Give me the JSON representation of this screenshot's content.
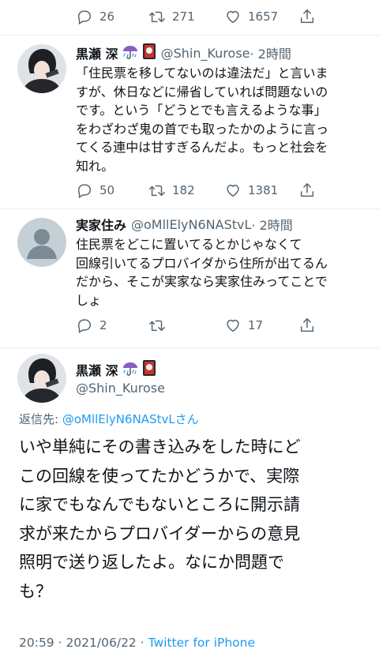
{
  "colors": {
    "link": "#1d9bf0",
    "muted": "#536471",
    "text": "#0f1419",
    "divider": "#e6ecf0"
  },
  "top_actions": {
    "replies": "26",
    "retweets": "271",
    "likes": "1657"
  },
  "tweet1": {
    "author": "黒瀬 深",
    "handle": "@Shin_Kurose",
    "time": "· 2時間",
    "lines": [
      "「住民票を移してないのは違法だ」と言いま",
      "すが、休日などに帰省していれば問題ないの",
      "です。という「どうとでも言えるような事」",
      "をわざわざ鬼の首でも取ったかのように言っ",
      "てくる連中は甘すぎるんだよ。もっと社会を",
      "知れ。"
    ],
    "replies": "50",
    "retweets": "182",
    "likes": "1381"
  },
  "tweet2": {
    "author": "実家住み",
    "handle": "@oMllElyN6NAStvL",
    "time": "· 2時間",
    "lines": [
      "住民票をどこに置いてるとかじゃなくて",
      "回線引いてるプロバイダから住所が出てるん",
      "だから、そこが実家なら実家住みってことで",
      "しょ"
    ],
    "replies": "2",
    "retweets": "",
    "likes": "17"
  },
  "main": {
    "author": "黒瀬 深",
    "handle": "@Shin_Kurose",
    "reply_label": "返信先: ",
    "reply_to": "@oMllElyN6NAStvLさん",
    "lines": [
      "いや単純にその書き込みをした時にど",
      "この回線を使ってたかどうかで、実際",
      "に家でもなんでもないところに開示請",
      "求が来たからプロバイダーからの意見",
      "照明で送り返したよ。なにか問題で",
      "も？"
    ],
    "meta": "20:59 · 2021/06/22 · ",
    "client": "Twitter for iPhone"
  },
  "icons": [
    "reply-icon",
    "retweet-icon",
    "like-icon",
    "share-icon",
    "umbrella-emoji-icon",
    "hanafuda-emoji-icon",
    "avatar-silhouette-icon"
  ]
}
